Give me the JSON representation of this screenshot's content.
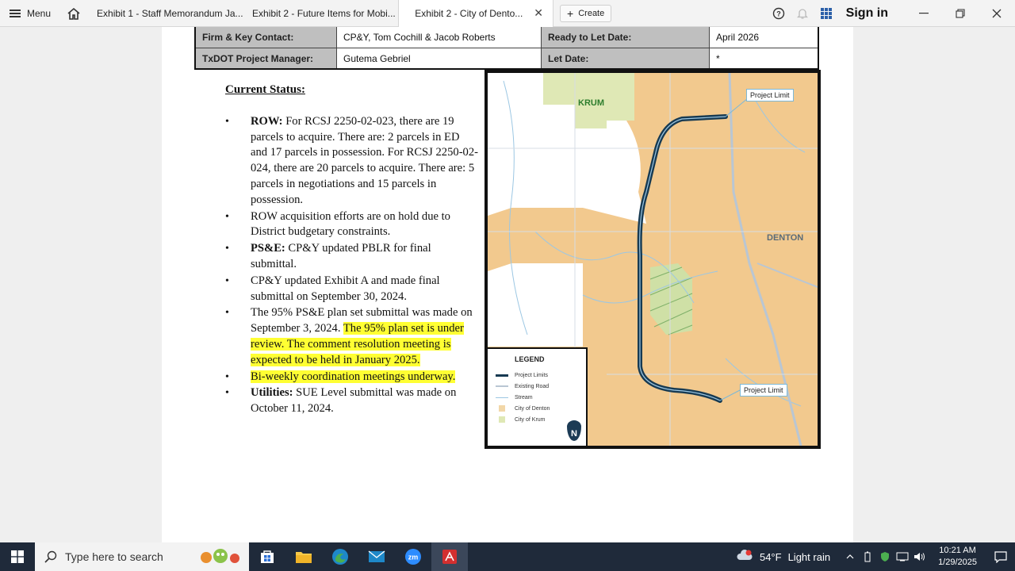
{
  "browser": {
    "menu_label": "Menu",
    "tabs": [
      {
        "label": "Exhibit 1 - Staff Memorandum Ja..."
      },
      {
        "label": "Exhibit 2 - Future Items for Mobi..."
      },
      {
        "label": "Exhibit 2 - City of Dento...",
        "active": true
      }
    ],
    "close_glyph": "✕",
    "create_label": "Create",
    "sign_in_label": "Sign in"
  },
  "info_table": {
    "rows": [
      {
        "label1": "Firm & Key Contact:",
        "value1": "CP&Y, Tom Cochill & Jacob Roberts",
        "label2": "Ready to Let Date:",
        "value2": "April 2026"
      },
      {
        "label1": "TxDOT Project Manager:",
        "value1": "Gutema Gebriel",
        "label2": "Let Date:",
        "value2": "*"
      }
    ]
  },
  "status": {
    "heading": "Current Status:",
    "items": [
      {
        "bold": "ROW:",
        "text": " For RCSJ 2250-02-023, there are 19 parcels to acquire.  There are: 2 parcels in ED and 17 parcels in possession.  For RCSJ 2250-02-024, there are 20 parcels to acquire.  There are: 5 parcels in negotiations and 15 parcels in possession."
      },
      {
        "text": "ROW acquisition efforts are on hold due to District budgetary constraints."
      },
      {
        "bold": "PS&E:",
        "text": " CP&Y updated PBLR for final submittal."
      },
      {
        "text": "CP&Y updated Exhibit A and made final submittal on September 30, 2024."
      },
      {
        "text": "The 95% PS&E plan set submittal was made on September 3, 2024.  ",
        "highlight": "The 95% plan set is under review.  The comment resolution meeting is expected to be held in January 2025."
      },
      {
        "highlight": "Bi-weekly coordination meetings underway."
      },
      {
        "bold": "Utilities:",
        "text": " SUE Level submittal was made on October 11, 2024."
      }
    ]
  },
  "map": {
    "label_krum": "KRUM",
    "label_denton": "DENTON",
    "project_limit_top": "Project Limit",
    "project_limit_bottom": "Project Limit",
    "legend_title": "LEGEND",
    "legend_items": [
      {
        "label": "Project Limits",
        "color": "#173a52"
      },
      {
        "label": "Existing Road",
        "color": "#b9c6d3"
      },
      {
        "label": "Stream",
        "color": "#9cc7e3"
      },
      {
        "label": "City of Denton",
        "color": "#f2d7a8"
      },
      {
        "label": "City of Krum",
        "color": "#dfe8b5"
      }
    ],
    "north_label": "N"
  },
  "taskbar": {
    "search_placeholder": "Type here to search",
    "weather_temp": "54°F",
    "weather_desc": "Light rain",
    "time": "10:21 AM",
    "date": "1/29/2025"
  }
}
